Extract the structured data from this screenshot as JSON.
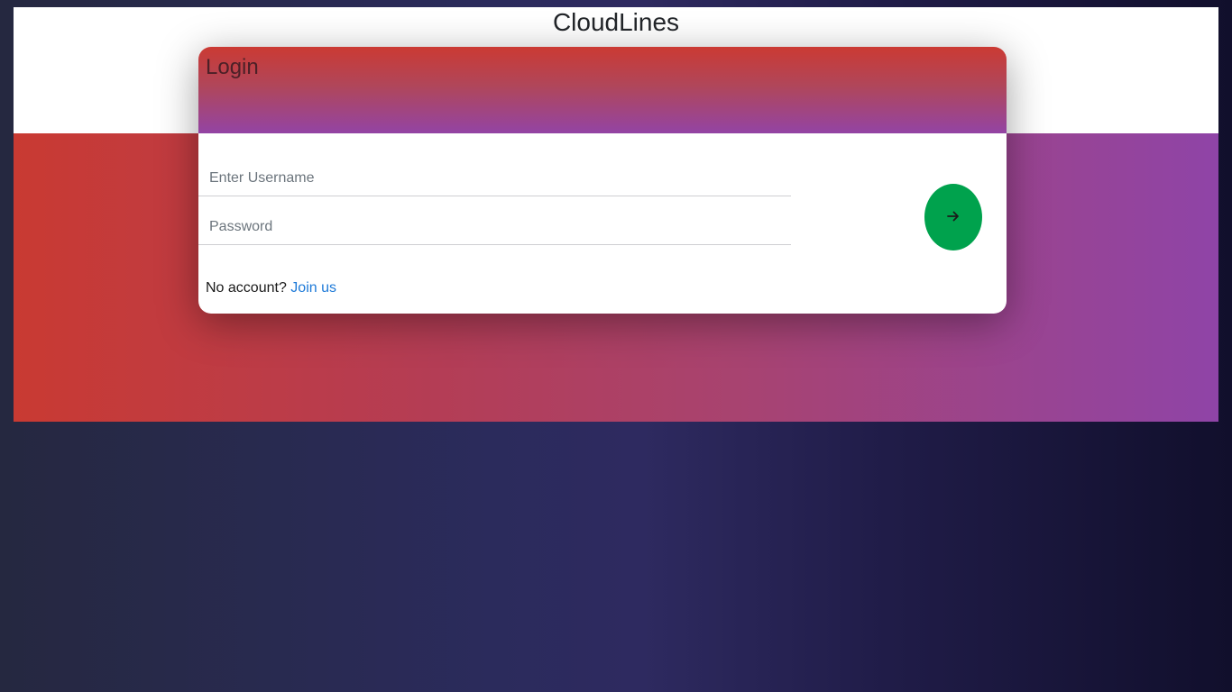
{
  "site": {
    "title": "CloudLines"
  },
  "login": {
    "title": "Login",
    "username_placeholder": "Enter Username",
    "password_placeholder": "Password",
    "submit_icon": "arrow-right-icon",
    "no_account_text": "No account?",
    "join_link": "Join us"
  },
  "colors": {
    "accent_green": "#00a24d",
    "link_blue": "#1e7ad8",
    "gradient_red": "#c93a32",
    "gradient_purple": "#8f44a7"
  }
}
